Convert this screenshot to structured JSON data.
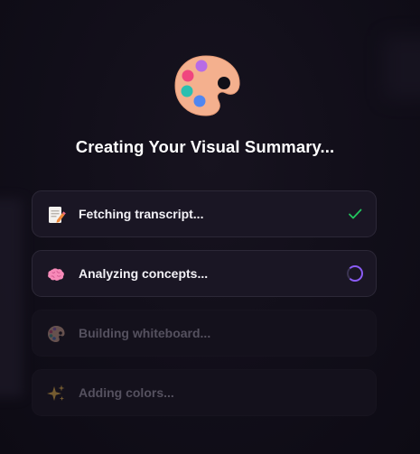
{
  "loader": {
    "title": "Creating Your Visual Summary...",
    "header_icon": "palette-icon"
  },
  "steps": [
    {
      "label": "Fetching transcript...",
      "icon": "memo-icon",
      "status": "done"
    },
    {
      "label": "Analyzing concepts...",
      "icon": "brain-icon",
      "status": "in-progress"
    },
    {
      "label": "Building whiteboard...",
      "icon": "palette-icon",
      "status": "pending"
    },
    {
      "label": "Adding colors...",
      "icon": "sparkles-icon",
      "status": "pending"
    }
  ],
  "colors": {
    "background": "#100d18",
    "card_active": "#1a1624",
    "card_pending": "#14111c",
    "check": "#22c55e",
    "spinner": "#8b5cf6",
    "text_active": "#f2f1f6",
    "text_pending": "#55515f"
  }
}
